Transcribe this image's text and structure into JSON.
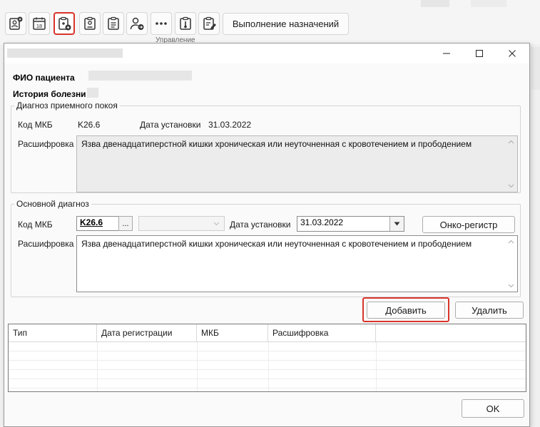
{
  "toolbar": {
    "buttons": [
      {
        "icon": "patient-card-icon"
      },
      {
        "icon": "calendar-icon",
        "text": "18"
      },
      {
        "icon": "clipboard-add-icon"
      },
      {
        "icon": "id-badge-icon"
      },
      {
        "icon": "clipboard-list-icon"
      },
      {
        "icon": "user-arrow-icon"
      },
      {
        "icon": "more-icon"
      },
      {
        "icon": "clipboard-thermometer-icon"
      },
      {
        "icon": "clipboard-edit-icon"
      }
    ],
    "text_button": "Выполнение назначений",
    "group_label": "Управление"
  },
  "dialog": {
    "patient_label": "ФИО пациента",
    "history_label": "История болезни",
    "admission": {
      "legend": "Диагноз приемного покоя",
      "mkb_label": "Код МКБ",
      "mkb_value": "K26.6",
      "date_label": "Дата установки",
      "date_value": "31.03.2022",
      "decode_label": "Расшифровка",
      "decode_text": "Язва двенадцатиперстной кишки хроническая или неуточненная с кровотечением и прободением"
    },
    "main": {
      "legend": "Основной диагноз",
      "mkb_label": "Код МКБ",
      "mkb_value": "K26.6",
      "browse_label": "...",
      "date_label": "Дата установки",
      "date_value": "31.03.2022",
      "onco_button": "Онко-регистр",
      "decode_label": "Расшифровка",
      "decode_text": "Язва двенадцатиперстной кишки хроническая или неуточненная с кровотечением и прободением"
    },
    "add_button": "Добавить",
    "delete_button": "Удалить",
    "table": {
      "columns": [
        "Тип",
        "Дата регистрации",
        "МКБ",
        "Расшифровка"
      ]
    },
    "ok_button": "OK"
  },
  "colors": {
    "highlight": "#d9342b"
  }
}
